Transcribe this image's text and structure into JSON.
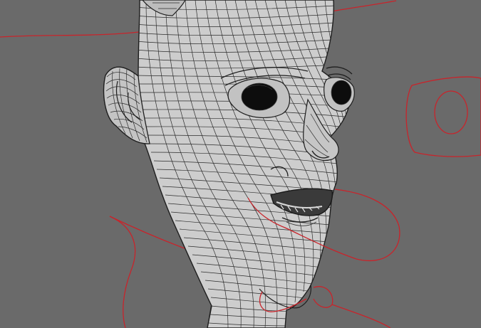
{
  "viewport": {
    "background_color": "#6a6a6a",
    "mesh_fill_color": "#cfcfcf",
    "mesh_line_color": "#2a2a2a",
    "curve_color": "#c8242b"
  },
  "icons": {
    "selection": "red-guide-curve-icon"
  }
}
